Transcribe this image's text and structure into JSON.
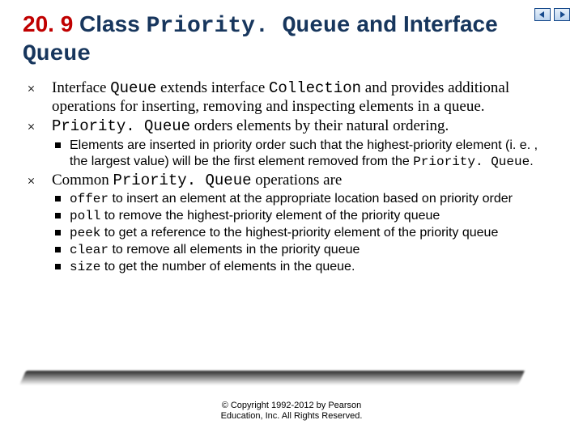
{
  "title": {
    "number": "20. 9",
    "plain1": "  Class ",
    "code1": "Priority. Queue",
    "plain2": " and Interface ",
    "code2": "Queue"
  },
  "bullets": {
    "b1": {
      "t0": "Interface ",
      "c0": "Queue",
      "t1": " extends interface ",
      "c1": "Collection",
      "t2": " and provides additional operations for inserting, removing and inspecting elements in a queue."
    },
    "b2": {
      "c0": "Priority. Queue",
      "t0": " orders elements by their natural ordering.",
      "sub": {
        "s1a": "Elements are inserted in priority order such that the highest-priority element (i. e. , the largest value) will be the first element removed from the ",
        "s1b": "Priority. Queue",
        "s1c": "."
      }
    },
    "b3": {
      "t0": "Common ",
      "c0": "Priority. Queue",
      "t1": " operations are",
      "sub": {
        "s1a": "offer",
        "s1b": " to insert an element at the appropriate location based on priority order",
        "s2a": "poll",
        "s2b": " to remove the highest-priority element of the priority queue",
        "s3a": "peek",
        "s3b": " to get a reference to the highest-priority element of the priority queue",
        "s4a": "clear",
        "s4b": " to remove all elements in the priority queue",
        "s5a": "size",
        "s5b": " to get the number of elements in the queue."
      }
    }
  },
  "copyright": {
    "line1": "© Copyright 1992-2012 by Pearson",
    "line2": "Education, Inc. All Rights Reserved."
  },
  "nav": {
    "prev": "previous",
    "next": "next"
  }
}
